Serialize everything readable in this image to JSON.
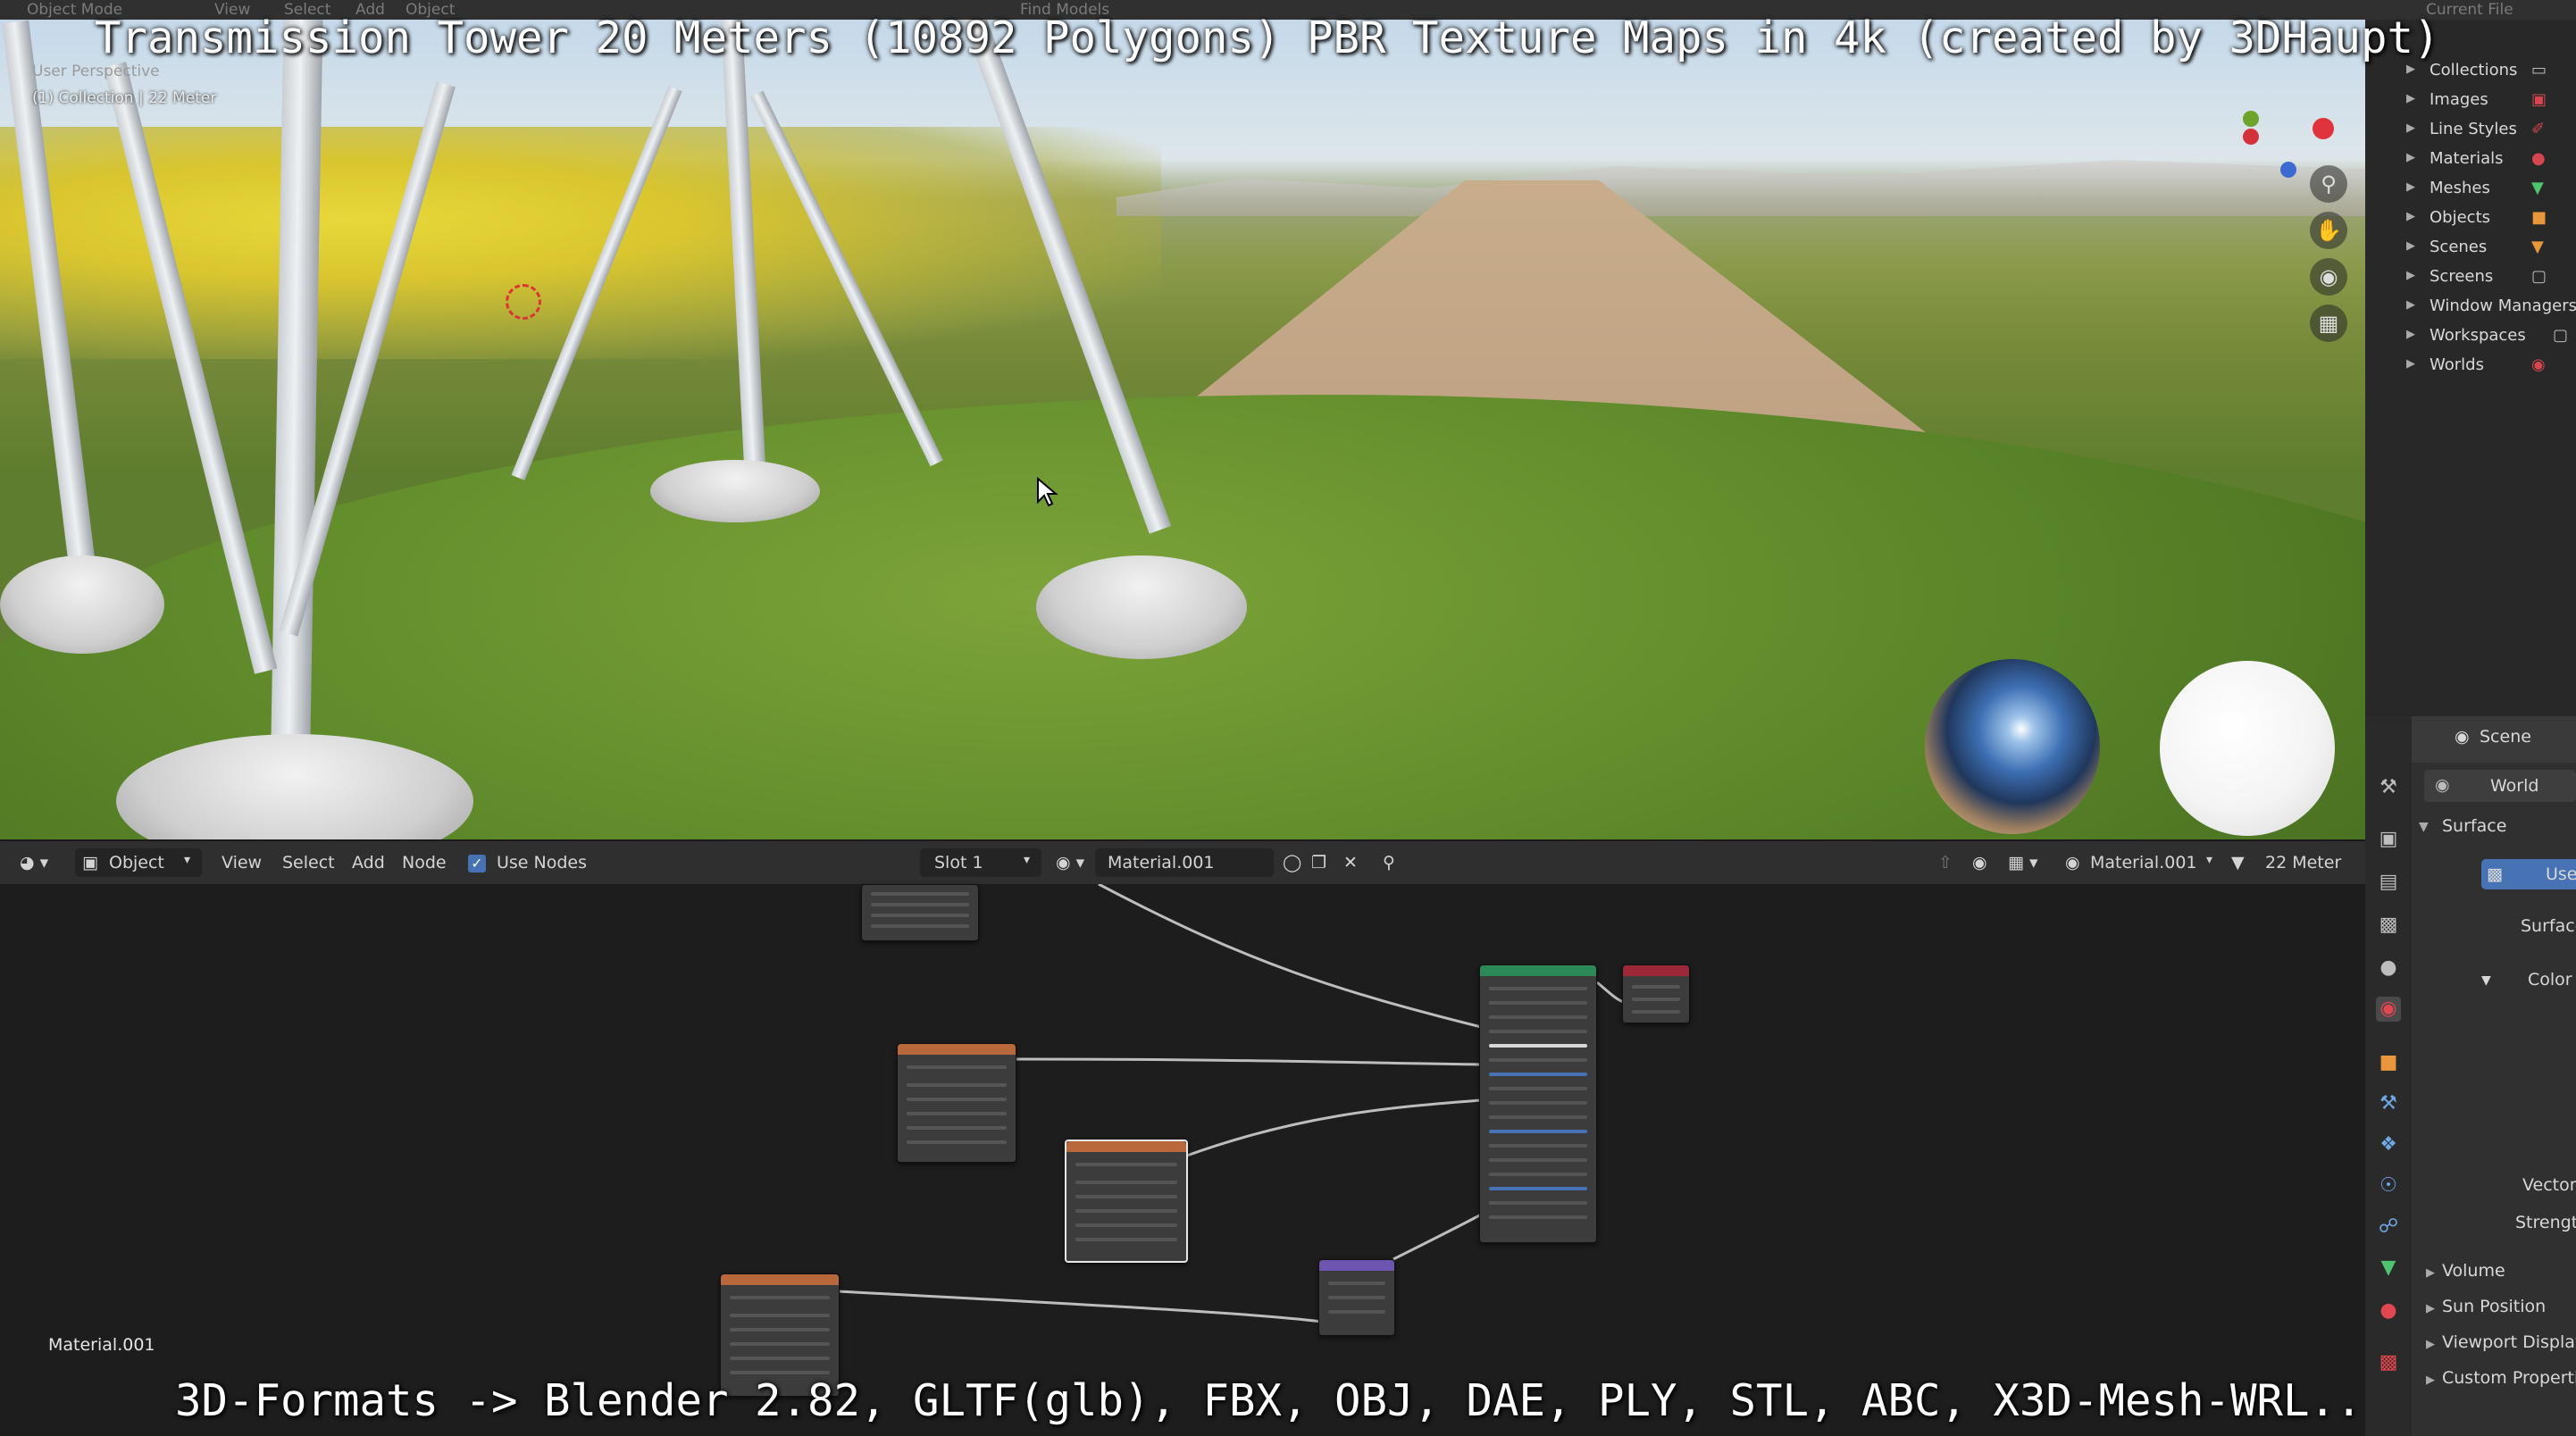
{
  "top_bar": {
    "mode": "Object Mode",
    "menus": [
      "View",
      "Select",
      "Add",
      "Object"
    ],
    "find_models": "Find Models",
    "outliner_display": "Current File"
  },
  "overlay_title": "Transmission Tower 20 Meters (10892 Polygons) PBR Texture Maps in 4k (created by 3DHaupt)",
  "overlay_formats": "3D-Formats -> Blender 2.82, GLTF(glb), FBX, OBJ, DAE, PLY, STL, ABC, X3D-Mesh-WRL..",
  "viewport": {
    "view_name": "User Perspective",
    "collection_label": "(1) Collection | 22 Meter",
    "nav_icons": [
      "zoom-icon",
      "pan-hand-icon",
      "camera-icon",
      "grid-ortho-icon"
    ]
  },
  "outliner": {
    "items": [
      {
        "label": "Collections",
        "icon": "collection-icon"
      },
      {
        "label": "Images",
        "icon": "image-icon"
      },
      {
        "label": "Line Styles",
        "icon": "linestyle-icon"
      },
      {
        "label": "Materials",
        "icon": "material-icon"
      },
      {
        "label": "Meshes",
        "icon": "mesh-icon"
      },
      {
        "label": "Objects",
        "icon": "object-icon"
      },
      {
        "label": "Scenes",
        "icon": "scene-icon"
      },
      {
        "label": "Screens",
        "icon": "screen-icon"
      },
      {
        "label": "Window Managers",
        "icon": "window-icon"
      },
      {
        "label": "Workspaces",
        "icon": "workspace-icon"
      },
      {
        "label": "Worlds",
        "icon": "world-icon"
      }
    ]
  },
  "properties": {
    "scene_label": "Scene",
    "world_label": "World",
    "surface_panel": "Surface",
    "use_button": "Use",
    "surface_field": "Surface",
    "color_field": "Color",
    "vector_field": "Vector",
    "strength_field": "Strength",
    "panels": [
      "Volume",
      "Sun Position",
      "Viewport Display",
      "Custom Properties"
    ]
  },
  "node_editor": {
    "editor_type": "Object",
    "menus": [
      "View",
      "Select",
      "Add",
      "Node"
    ],
    "use_nodes_label": "Use Nodes",
    "use_nodes_checked": true,
    "slot": "Slot 1",
    "material_name": "Material.001",
    "material_right": "Material.001",
    "object_name": "22 Meter",
    "footer_material": "Material.001"
  },
  "colors": {
    "texture_node": "#b8683b",
    "bsdf_node": "#2c8a58",
    "output_node": "#9c2838",
    "normal_node": "#6c54b0",
    "header": "#303030",
    "selection_blue": "#4772b3"
  }
}
